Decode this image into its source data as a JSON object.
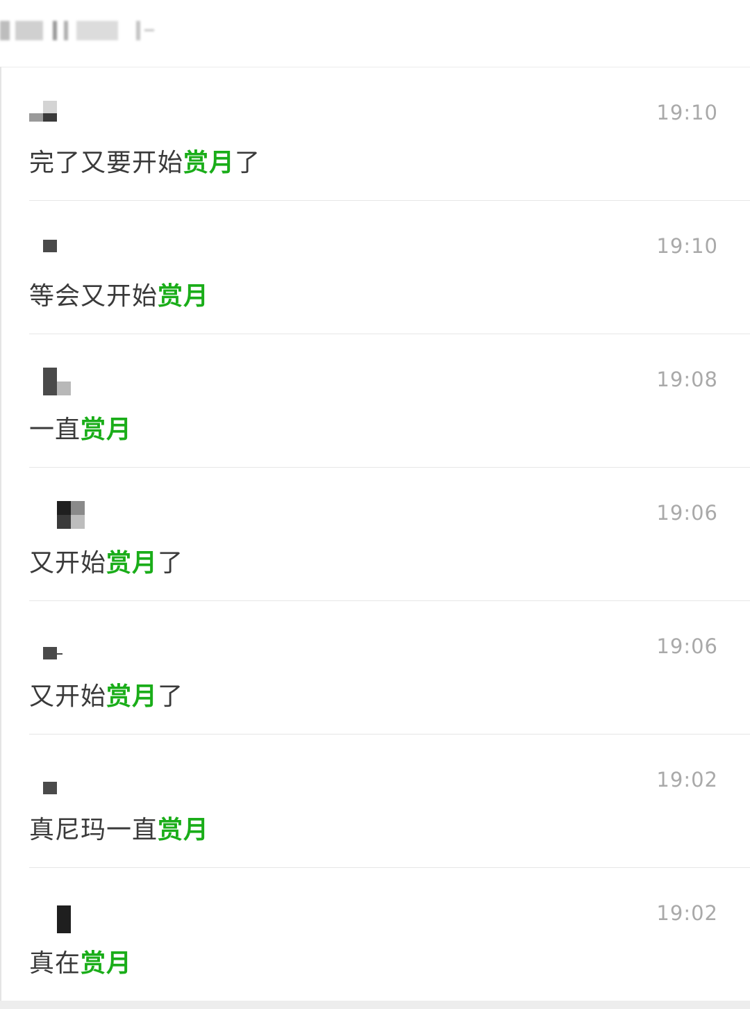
{
  "theme": {
    "highlight_color": "#1aad19",
    "text_color": "#3a3a3a",
    "time_color": "#a9a9a9"
  },
  "messages": [
    {
      "avatar_icon": "pixelated-avatar-icon",
      "time": "19:10",
      "text_before": "完了又要开始",
      "highlight": "赏月",
      "text_after": "了"
    },
    {
      "avatar_icon": "pixelated-avatar-icon",
      "time": "19:10",
      "text_before": "等会又开始",
      "highlight": "赏月",
      "text_after": ""
    },
    {
      "avatar_icon": "pixelated-avatar-icon",
      "time": "19:08",
      "text_before": "一直",
      "highlight": "赏月",
      "text_after": ""
    },
    {
      "avatar_icon": "pixelated-avatar-icon",
      "time": "19:06",
      "text_before": "又开始",
      "highlight": "赏月",
      "text_after": "了"
    },
    {
      "avatar_icon": "pixelated-avatar-icon",
      "time": "19:06",
      "text_before": "又开始",
      "highlight": "赏月",
      "text_after": "了"
    },
    {
      "avatar_icon": "pixelated-avatar-icon",
      "time": "19:02",
      "text_before": "真尼玛一直",
      "highlight": "赏月",
      "text_after": ""
    },
    {
      "avatar_icon": "pixelated-avatar-icon",
      "time": "19:02",
      "text_before": "真在",
      "highlight": "赏月",
      "text_after": ""
    }
  ]
}
